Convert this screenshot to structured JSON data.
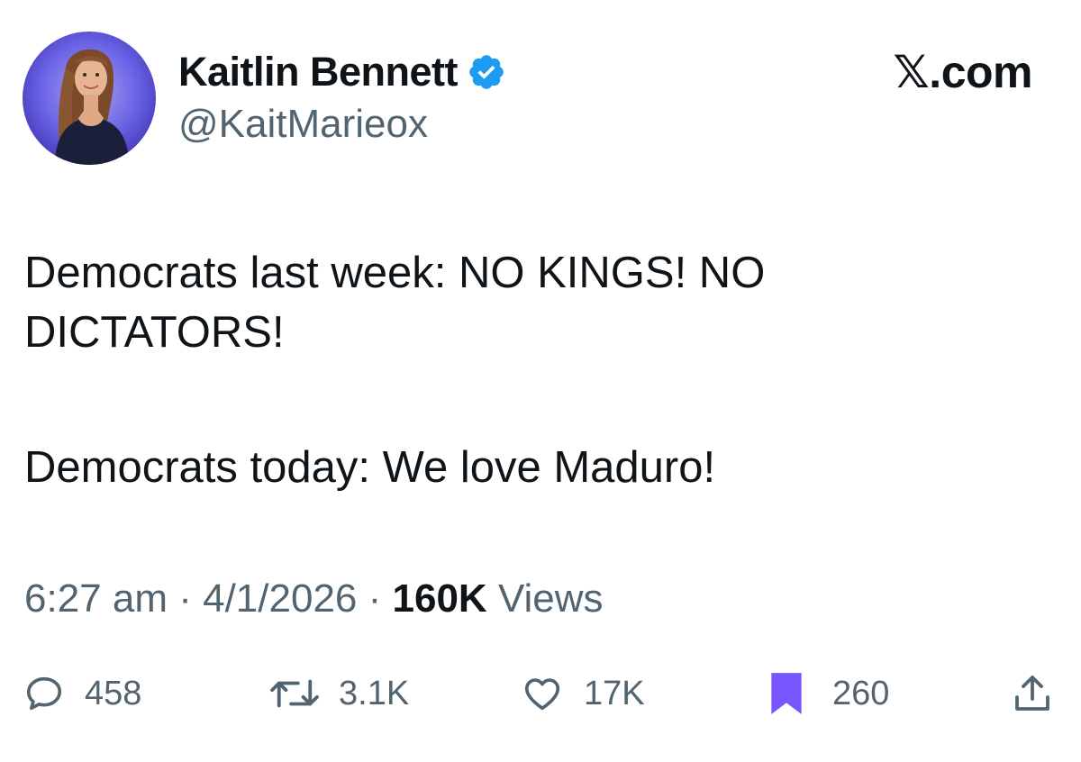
{
  "author": {
    "display_name": "Kaitlin Bennett",
    "handle": "@KaitMarieox",
    "verified": true,
    "avatar_icon": "profile-photo"
  },
  "site_label": {
    "glyph": "𝕏",
    "text": ".com"
  },
  "tweet": {
    "lines": [
      "Democrats last week: NO KINGS! NO",
      "DICTATORS!",
      "Democrats today: We love Maduro!"
    ]
  },
  "meta": {
    "time": "6:27 am",
    "separator": "·",
    "date": "4/1/2026",
    "views_count": "160K",
    "views_label": "Views"
  },
  "actions": {
    "replies": {
      "icon": "reply-icon",
      "count": "458"
    },
    "reposts": {
      "icon": "repost-icon",
      "count": "3.1K"
    },
    "likes": {
      "icon": "heart-icon",
      "count": "17K"
    },
    "bookmarks": {
      "icon": "bookmark-icon",
      "count": "260",
      "active": true
    },
    "share": {
      "icon": "share-icon"
    }
  },
  "colors": {
    "text_primary": "#0f1419",
    "text_secondary": "#536471",
    "verified_blue": "#1d9bf0",
    "bookmark_purple": "#7856ff",
    "avatar_bg": "#6b63e6"
  }
}
